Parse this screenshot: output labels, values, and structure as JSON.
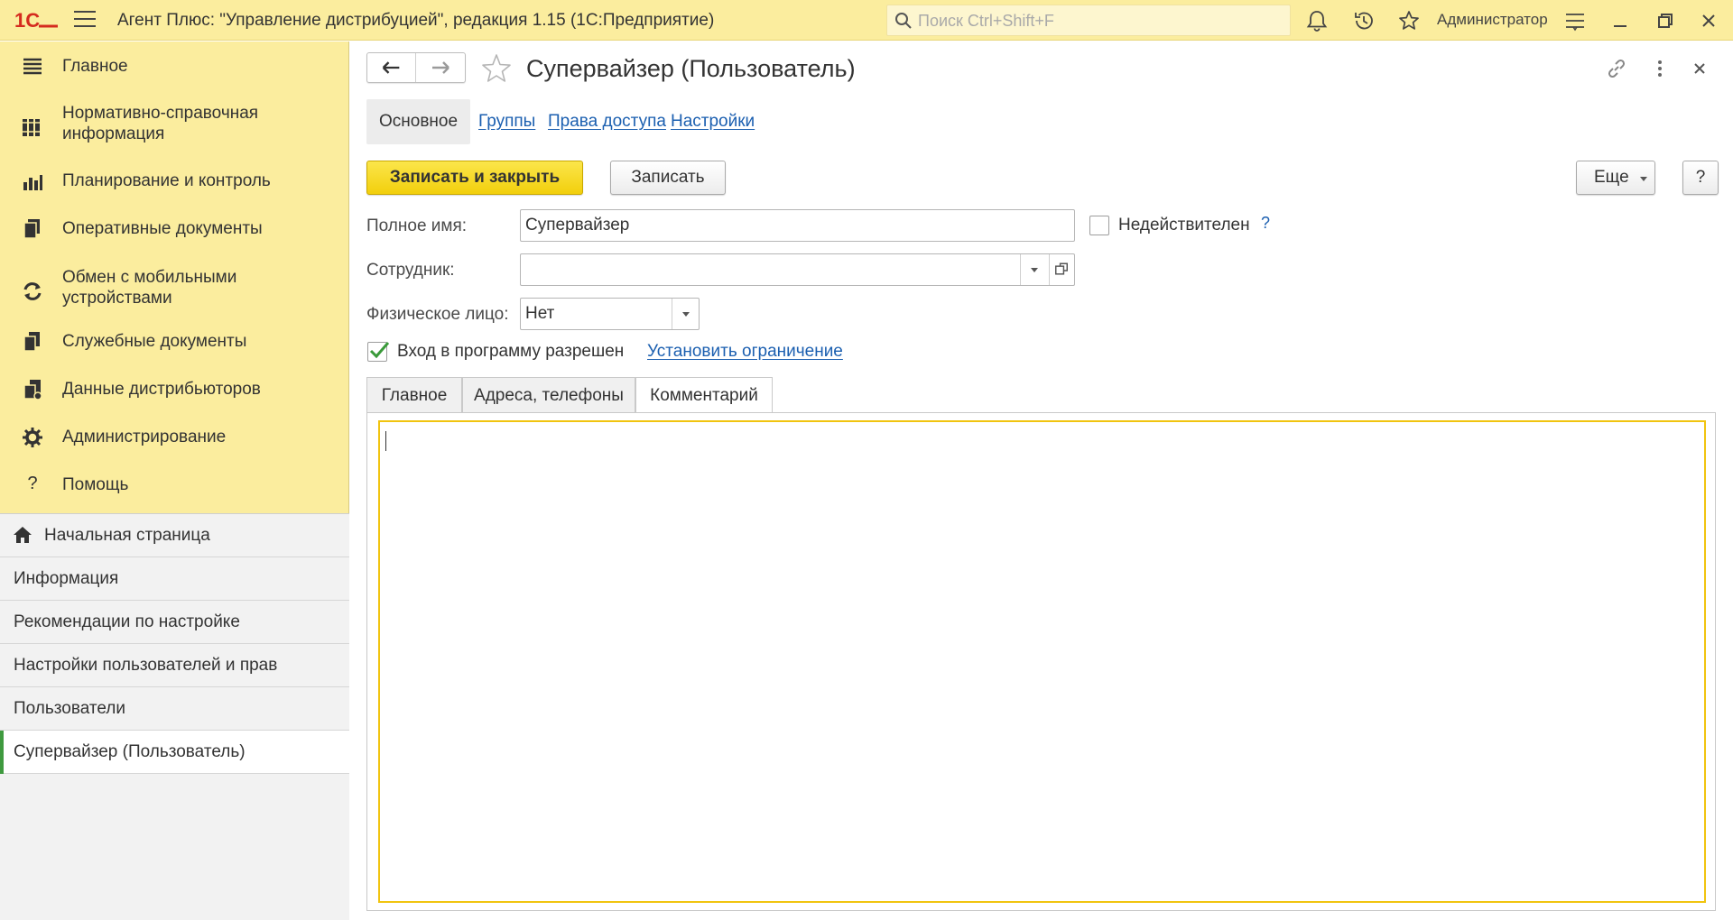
{
  "titlebar": {
    "app_title": "Агент Плюс: \"Управление дистрибуцией\", редакция 1.15  (1С:Предприятие)",
    "search_placeholder": "Поиск Ctrl+Shift+F",
    "user": "Администратор"
  },
  "sidebar": {
    "sections": [
      {
        "label": "Главное",
        "icon": "menu-lines-icon"
      },
      {
        "label": "Нормативно-справочная информация",
        "icon": "reference-books-icon"
      },
      {
        "label": "Планирование и контроль",
        "icon": "bar-chart-icon"
      },
      {
        "label": "Оперативные документы",
        "icon": "documents-icon"
      },
      {
        "label": "Обмен с мобильными устройствами",
        "icon": "sync-icon"
      },
      {
        "label": "Служебные документы",
        "icon": "service-docs-icon"
      },
      {
        "label": "Данные дистрибьюторов",
        "icon": "distributor-data-icon"
      },
      {
        "label": "Администрирование",
        "icon": "gear-icon"
      },
      {
        "label": "Помощь",
        "icon": "question-icon"
      }
    ],
    "open_windows": [
      {
        "label": "Начальная страница"
      },
      {
        "label": "Информация"
      },
      {
        "label": "Рекомендации по настройке"
      },
      {
        "label": "Настройки пользователей и прав"
      },
      {
        "label": "Пользователи"
      },
      {
        "label": "Супервайзер (Пользователь)"
      }
    ]
  },
  "form": {
    "title": "Супервайзер (Пользователь)",
    "tabs": [
      "Основное",
      "Группы",
      "Права доступа",
      "Настройки"
    ],
    "save_close_label": "Записать и закрыть",
    "save_label": "Записать",
    "more_label": "Еще",
    "help_label": "?",
    "full_name_label": "Полное имя:",
    "full_name_value": "Супервайзер",
    "invalid_label": "Недействителен",
    "invalid_help": "?",
    "employee_label": "Сотрудник:",
    "employee_value": "",
    "person_label": "Физическое лицо:",
    "person_value": "Нет",
    "login_allowed_label": "Вход в программу разрешен",
    "login_allowed_checked": true,
    "set_restriction_link": "Установить ограничение",
    "page_tabs": [
      "Главное",
      "Адреса, телефоны",
      "Комментарий"
    ],
    "active_page_tab": "Комментарий",
    "comment_value": ""
  },
  "colors": {
    "titlebar_bg": "#fbed9e",
    "primary_button": "#f2cf0c",
    "link": "#1b5fb0",
    "highlight": "#e01919",
    "active_indicator": "#3f9a3f"
  }
}
